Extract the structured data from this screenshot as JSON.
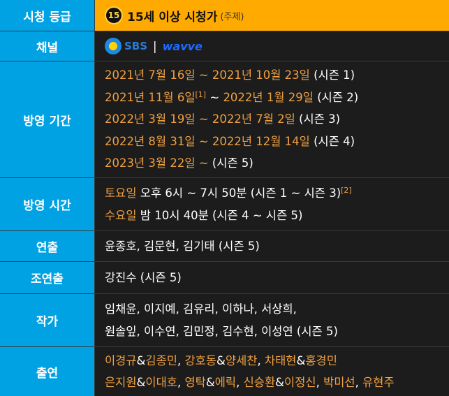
{
  "rating": {
    "label": "시청 등급",
    "badge": "15",
    "text": "15세 이상 시청가",
    "note": "(주제)"
  },
  "channel": {
    "label": "채널",
    "sbs": "SBS",
    "separator": "|",
    "wavve": "wavve"
  },
  "airing_period": {
    "label": "방영 기간",
    "lines": [
      {
        "dates": "2021년 7월 16일 ~ 2021년 10월 23일",
        "note": "(시즌 1)"
      },
      {
        "d1": "2021년 11월 6일",
        "ref": "[1]",
        "mid": " ~ ",
        "d2": "2022년 1월 29일",
        "note": " (시즌 2)"
      },
      {
        "dates": "2022년 3월 19일 ~ 2022년 7월 2일",
        "note": "(시즌 3)"
      },
      {
        "dates": "2022년 8월 31일 ~ 2022년 12월 14일",
        "note": "(시즌 4)"
      },
      {
        "dates": "2023년 3월 22일 ~",
        "note": "(시즌 5)"
      }
    ]
  },
  "airing_time": {
    "label": "방영 시간",
    "lines": [
      {
        "day": "토요일",
        "time": " 오후 6시 ~ 7시 50분 (시즌 1 ~ 시즌 3)",
        "ref": "[2]"
      },
      {
        "day": "수요일",
        "time": " 밤 10시 40분 (시즌 4 ~ 시즌 5)"
      }
    ]
  },
  "director": {
    "label": "연출",
    "text": "윤종호, 김문현, 김기태 (시즌 5)"
  },
  "co_director": {
    "label": "조연출",
    "text": "강진수 (시즌 5)"
  },
  "writer": {
    "label": "작가",
    "lines": [
      "임채윤, 이지예, 김유리, 이하나, 서상희,",
      "원솔잎, 이수연, 김민정, 김수현, 이성연 (시즌 5)"
    ]
  },
  "cast": {
    "label": "출연",
    "line1": [
      "이경규",
      "&",
      "김종민",
      ", ",
      "강호동",
      "&",
      "양세찬",
      ", ",
      "차태현",
      "&",
      "홍경민"
    ],
    "line2": [
      "은지원",
      "&",
      "이대호",
      ", ",
      "영탁",
      "&",
      "에릭",
      ", ",
      "신승환",
      "&",
      "이정신",
      ", ",
      "박미선",
      ", ",
      "유현주"
    ]
  }
}
